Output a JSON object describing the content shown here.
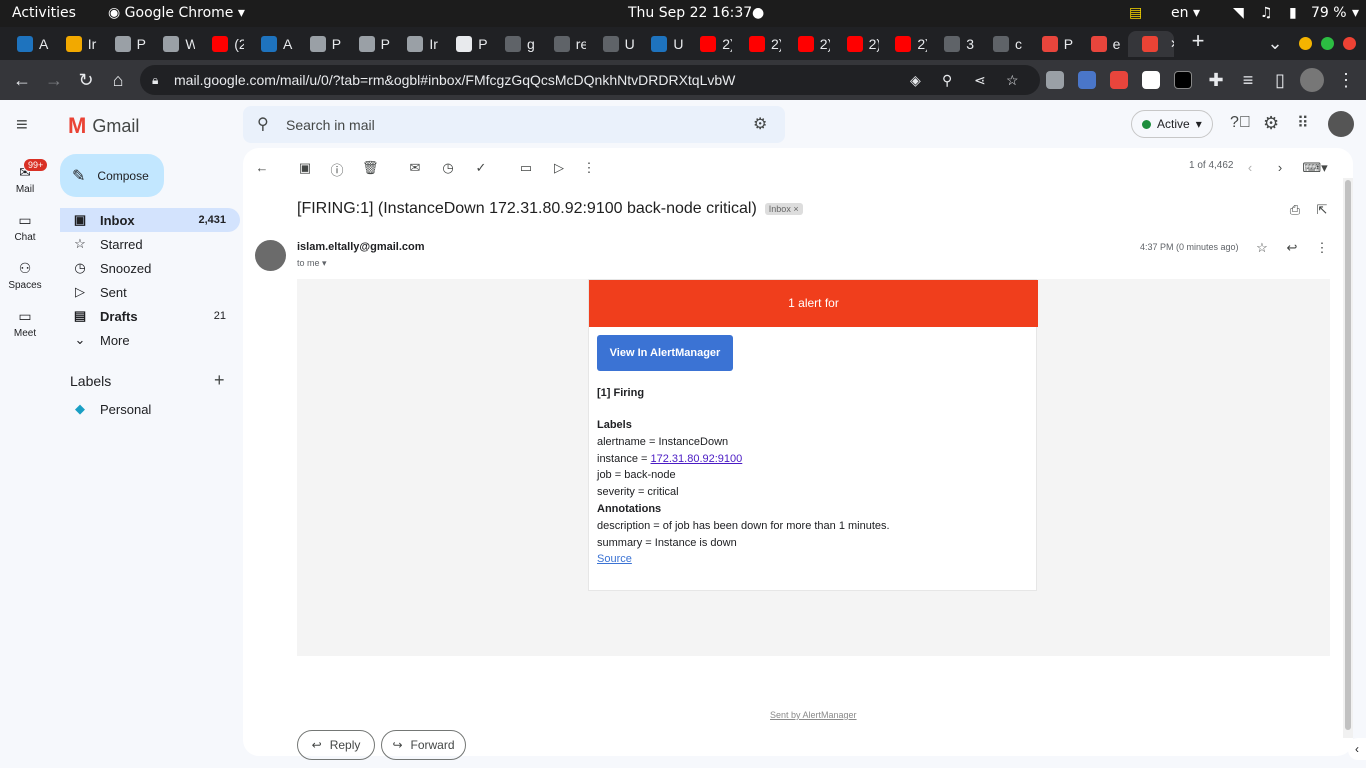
{
  "os": {
    "activities": "Activities",
    "app": "Google Chrome",
    "clock": "Thu Sep 22  16:37",
    "lang": "en",
    "battery": "79 %"
  },
  "browser": {
    "tabs": [
      {
        "letter": "A",
        "icon": "uppercase-icon",
        "color": "#1e73be"
      },
      {
        "letter": "Ir",
        "icon": "box-icon",
        "color": "#f2a900"
      },
      {
        "letter": "P",
        "icon": "page-icon",
        "color": "#9aa0a6"
      },
      {
        "letter": "W",
        "icon": "globe-icon",
        "color": "#9aa0a6"
      },
      {
        "letter": "(2",
        "icon": "youtube-icon",
        "color": "#ff0000"
      },
      {
        "letter": "A",
        "icon": "uppercase-icon",
        "color": "#1e73be"
      },
      {
        "letter": "P",
        "icon": "page-icon",
        "color": "#9aa0a6"
      },
      {
        "letter": "P",
        "icon": "page-icon",
        "color": "#9aa0a6"
      },
      {
        "letter": "Ir",
        "icon": "page-icon",
        "color": "#9aa0a6"
      },
      {
        "letter": "P",
        "icon": "target-icon",
        "color": "#e8eaed"
      },
      {
        "letter": "g",
        "icon": "github-icon",
        "color": "#5f6368"
      },
      {
        "letter": "re",
        "icon": "github-icon",
        "color": "#5f6368"
      },
      {
        "letter": "U",
        "icon": "github-icon",
        "color": "#5f6368"
      },
      {
        "letter": "U",
        "icon": "uppercase-icon",
        "color": "#1e73be"
      },
      {
        "letter": "2)",
        "icon": "youtube-icon",
        "color": "#ff0000"
      },
      {
        "letter": "2)",
        "icon": "youtube-icon",
        "color": "#ff0000"
      },
      {
        "letter": "2)",
        "icon": "youtube-icon",
        "color": "#ff0000"
      },
      {
        "letter": "2)",
        "icon": "youtube-icon",
        "color": "#ff0000"
      },
      {
        "letter": "2)",
        "icon": "youtube-icon",
        "color": "#ff0000"
      },
      {
        "letter": "3",
        "icon": "loading-icon",
        "color": "#5f6368"
      },
      {
        "letter": "c",
        "icon": "github-icon",
        "color": "#5f6368"
      },
      {
        "letter": "P",
        "icon": "podcast-icon",
        "color": "#e8453c"
      },
      {
        "letter": "e",
        "icon": "podcast-icon",
        "color": "#e8453c"
      },
      {
        "letter": "",
        "icon": "gmail-icon",
        "color": "#ea4335"
      }
    ],
    "url": "mail.google.com/mail/u/0/?tab=rm&ogbl#inbox/FMfcgzGqQcsMcDQnkhNtvDRDRXtqLvbW"
  },
  "gmail": {
    "brand": "Gmail",
    "search_placeholder": "Search in mail",
    "status": "Active",
    "compose": "Compose",
    "rail": [
      {
        "label": "Mail",
        "badge": "99+"
      },
      {
        "label": "Chat"
      },
      {
        "label": "Spaces"
      },
      {
        "label": "Meet"
      }
    ],
    "nav": [
      {
        "label": "Inbox",
        "count": "2,431"
      },
      {
        "label": "Starred",
        "count": ""
      },
      {
        "label": "Snoozed",
        "count": ""
      },
      {
        "label": "Sent",
        "count": ""
      },
      {
        "label": "Drafts",
        "count": "21"
      },
      {
        "label": "More",
        "count": ""
      }
    ],
    "labels_title": "Labels",
    "labels": [
      {
        "label": "Personal",
        "color": "#1a9fc4"
      }
    ],
    "pager": "1 of 4,462",
    "subject": "[FIRING:1] (InstanceDown 172.31.80.92:9100 back-node critical)",
    "inbox_chip": "Inbox",
    "sender": "islam.eltally@gmail.com",
    "to": "to me",
    "time": "4:37 PM (0 minutes ago)",
    "alert": {
      "header": "1 alert for",
      "button": "View In AlertManager",
      "firing": "[1] Firing",
      "labels_title": "Labels",
      "alertname": "alertname = InstanceDown",
      "instance_prefix": "instance = ",
      "instance_link": "172.31.80.92:9100",
      "job": "job = back-node",
      "severity": "severity = critical",
      "annotations_title": "Annotations",
      "description": "description = of job has been down for more than 1 minutes.",
      "summary": "summary = Instance is down",
      "source": "Source",
      "footer": "Sent by AlertManager"
    },
    "reply": "Reply",
    "forward": "Forward"
  }
}
